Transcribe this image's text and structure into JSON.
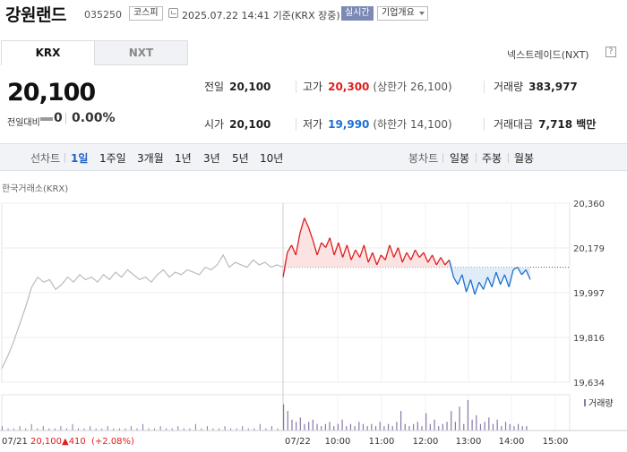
{
  "header": {
    "title": "강원랜드",
    "code": "035250",
    "market": "코스피",
    "timestamp": "2025.07.22 14:41 기준(KRX 장중)",
    "realtime": "실시간",
    "overview": "기업개요"
  },
  "tabs": [
    {
      "label": "KRX",
      "active": true
    },
    {
      "label": "NXT",
      "active": false
    }
  ],
  "nxt_link": "넥스트레이드(NXT)",
  "nxt_link_icon": "?",
  "price": {
    "current": "20,100",
    "change_label": "전일대비",
    "change_value": "0",
    "change_pct": "0.00%"
  },
  "stats": {
    "prev_close": {
      "label": "전일",
      "value": "20,100"
    },
    "high": {
      "label": "고가",
      "value": "20,300",
      "limit": "(상한가 26,100)"
    },
    "volume": {
      "label": "거래량",
      "value": "383,977"
    },
    "open": {
      "label": "시가",
      "value": "20,100"
    },
    "low": {
      "label": "저가",
      "value": "19,990",
      "limit": "(하한가 14,100)"
    },
    "amount": {
      "label": "거래대금",
      "value": "7,718 백만"
    }
  },
  "period_bar": {
    "line_label": "선차트",
    "periods": [
      "1일",
      "1주일",
      "3개월",
      "1년",
      "3년",
      "5년",
      "10년"
    ],
    "active_period": "1일",
    "candle_label": "봉차트",
    "candles": [
      "일봉",
      "주봉",
      "월봉"
    ]
  },
  "chart_data": {
    "type": "line",
    "source_label": "한국거래소(KRX)",
    "volume_label": "거래량",
    "y_ticks": [
      "20,360",
      "20,179",
      "19,997",
      "19,816",
      "19,634"
    ],
    "ylim": [
      19634,
      20360
    ],
    "baseline": 20100,
    "prev_day": {
      "date_label": "07/21",
      "close": "20,100",
      "change": "▲410",
      "change_pct": "(+2.08%)",
      "values": [
        19690,
        19740,
        19800,
        19870,
        19940,
        20020,
        20060,
        20040,
        20050,
        20010,
        20030,
        20060,
        20040,
        20070,
        20050,
        20060,
        20040,
        20070,
        20050,
        20080,
        20060,
        20090,
        20070,
        20050,
        20060,
        20040,
        20070,
        20090,
        20060,
        20080,
        20070,
        20090,
        20080,
        20070,
        20100,
        20090,
        20110,
        20150,
        20100,
        20120,
        20110,
        20100,
        20130,
        20110,
        20120,
        20100,
        20110,
        20100
      ]
    },
    "today": {
      "date_label": "07/22",
      "x_ticks": [
        "10:00",
        "11:00",
        "12:00",
        "13:00",
        "14:00",
        "15:00"
      ],
      "values": [
        20060,
        20160,
        20190,
        20150,
        20240,
        20300,
        20260,
        20210,
        20150,
        20200,
        20180,
        20220,
        20150,
        20200,
        20140,
        20190,
        20130,
        20170,
        20140,
        20190,
        20120,
        20160,
        20110,
        20150,
        20130,
        20190,
        20140,
        20180,
        20120,
        20160,
        20130,
        20170,
        20140,
        20160,
        20120,
        20150,
        20110,
        20140,
        20110,
        20130,
        20060,
        20030,
        20070,
        20000,
        20050,
        19990,
        20040,
        20010,
        20060,
        20020,
        20080,
        20030,
        20070,
        20020,
        20090,
        20100,
        20070,
        20090,
        20050
      ]
    },
    "volume_prev": [
      2,
      1,
      1,
      2,
      1,
      3,
      1,
      2,
      1,
      1,
      2,
      1,
      3,
      1,
      1,
      2,
      1,
      1,
      2,
      1,
      1,
      1,
      2,
      1,
      3,
      1,
      1,
      2,
      1,
      1,
      2,
      1,
      1,
      3,
      1,
      2,
      1,
      1,
      2,
      1,
      1,
      2,
      1,
      1,
      3,
      1,
      2,
      1
    ],
    "volume_today": [
      12,
      9,
      5,
      4,
      6,
      3,
      4,
      5,
      3,
      2,
      3,
      4,
      2,
      3,
      5,
      2,
      3,
      2,
      4,
      3,
      2,
      3,
      2,
      4,
      2,
      3,
      2,
      4,
      9,
      3,
      2,
      3,
      4,
      2,
      8,
      3,
      5,
      2,
      3,
      4,
      9,
      4,
      11,
      3,
      14,
      5,
      7,
      3,
      4,
      6,
      3,
      5,
      2,
      4,
      3,
      2,
      3,
      2,
      2
    ],
    "colors": {
      "up": "#e01d1d",
      "down": "#1e6fd1",
      "flat": "#bbbbbb",
      "volume": "#8877aa"
    }
  }
}
